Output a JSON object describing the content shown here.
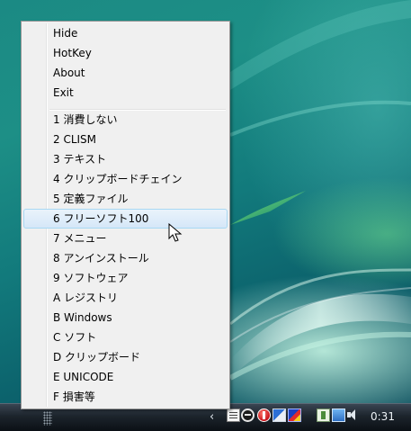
{
  "menu": {
    "items": [
      {
        "label": "Hide"
      },
      {
        "label": "HotKey"
      },
      {
        "label": "About"
      },
      {
        "label": "Exit"
      }
    ],
    "categories": [
      {
        "label": "1 消費しない"
      },
      {
        "label": "2 CLISM"
      },
      {
        "label": "3 テキスト"
      },
      {
        "label": "4 クリップボードチェイン"
      },
      {
        "label": "5 定義ファイル"
      },
      {
        "label": "6 フリーソフト100",
        "highlighted": true
      },
      {
        "label": "7 メニュー"
      },
      {
        "label": "8 アンインストール"
      },
      {
        "label": "9 ソフトウェア"
      },
      {
        "label": "A レジストリ"
      },
      {
        "label": "B Windows"
      },
      {
        "label": "C ソフト"
      },
      {
        "label": "D クリップボード"
      },
      {
        "label": "E UNICODE"
      },
      {
        "label": "F 損害等"
      }
    ],
    "highlight_color": "#d5e7f8"
  },
  "taskbar": {
    "tray_icons": [
      "notepad-icon",
      "clock-app-icon",
      "red-app-icon",
      "flag-icon",
      "network-app-icon",
      "plug-icon",
      "monitor-icon",
      "volume-icon"
    ],
    "clock": "0:31"
  }
}
